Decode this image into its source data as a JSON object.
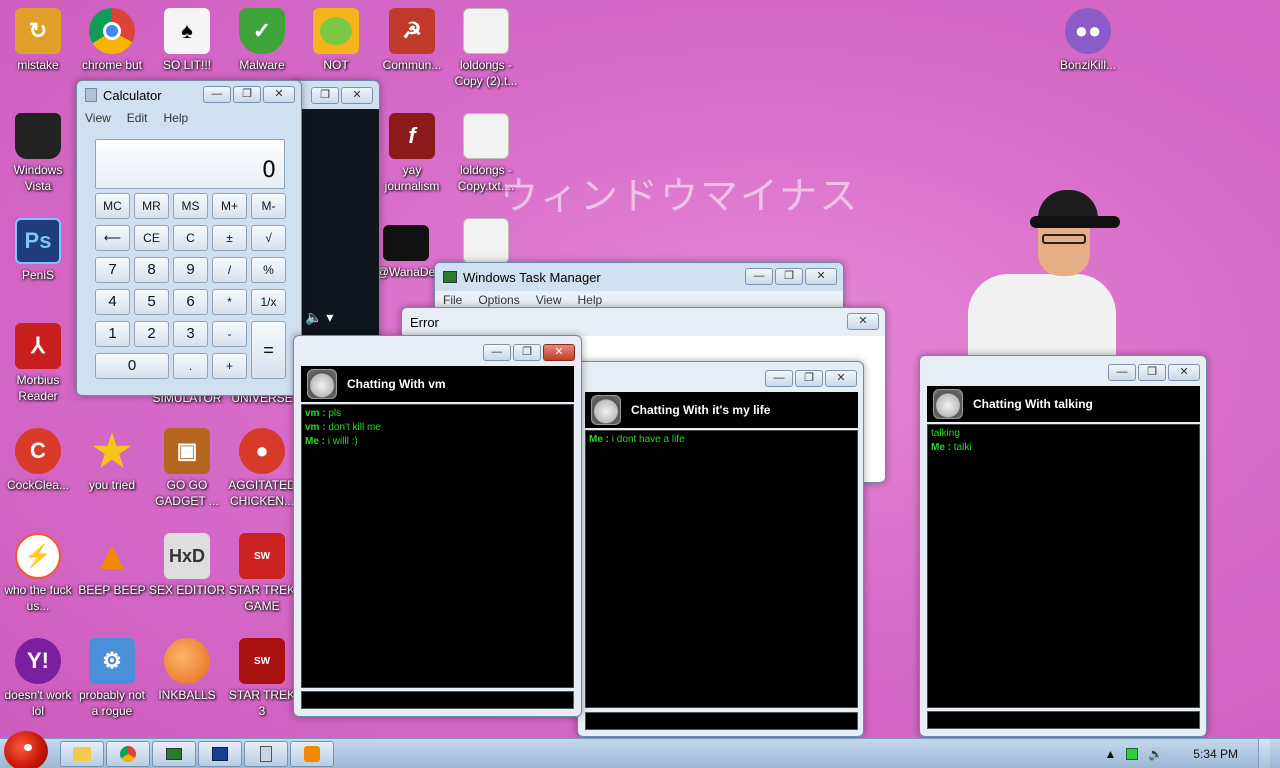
{
  "desktop_icons": [
    {
      "label": "mistake",
      "icon": "folder-arrow-icon",
      "color": "#e0a02a"
    },
    {
      "label": "chrome but",
      "icon": "chrome-icon",
      "color": "#3a7be8"
    },
    {
      "label": "SO LIT!!!",
      "icon": "cards-icon",
      "color": "#f5f5f5"
    },
    {
      "label": "Malware",
      "icon": "shield-check-icon",
      "color": "#3ea43a"
    },
    {
      "label": "NOT",
      "icon": "angry-pig-icon",
      "color": "#7ac943"
    },
    {
      "label": "Commun...",
      "icon": "communism-icon",
      "color": "#c0392b"
    },
    {
      "label": "loldongs - Copy (2).t...",
      "icon": "text-file-icon",
      "color": "#f2f2f2"
    },
    {
      "label": "BonziKill...",
      "icon": "purple-gorilla-icon",
      "color": "#8b5bc7"
    },
    {
      "label": "Windows Vista",
      "icon": "trash-can-icon",
      "color": "#222222"
    },
    {
      "label": "yay journalism",
      "icon": "flash-icon",
      "color": "#8b1a1a"
    },
    {
      "label": "loldongs - Copy.txt....",
      "icon": "text-file-icon",
      "color": "#f2f2f2"
    },
    {
      "label": "PeniS",
      "icon": "photoshop-icon",
      "color": "#1f3d7a"
    },
    {
      "label": "@WanaDe",
      "icon": "black-file-icon",
      "color": "#111111"
    },
    {
      "label": "Morbius Reader",
      "icon": "pdf-icon",
      "color": "#c81e1e"
    },
    {
      "label": "SIMULATOR",
      "icon": "",
      "color": ""
    },
    {
      "label": "UNIVERSE",
      "icon": "",
      "color": ""
    },
    {
      "label": "CockClea...",
      "icon": "ccleaner-icon",
      "color": "#d93a2a"
    },
    {
      "label": "you tried",
      "icon": "star-icon",
      "color": "#f5c518"
    },
    {
      "label": "GO GO GADGET ...",
      "icon": "briefcase-icon",
      "color": "#b5651d"
    },
    {
      "label": "AGGITATED CHICKEN...",
      "icon": "angry-bird-icon",
      "color": "#d63a2a"
    },
    {
      "label": "who the fuck us...",
      "icon": "lightning-icon",
      "color": "#f05a28"
    },
    {
      "label": "BEEP BEEP",
      "icon": "vlc-cone-icon",
      "color": "#f08a00"
    },
    {
      "label": "SEX EDITIOR",
      "icon": "hxd-icon",
      "color": "#dddddd"
    },
    {
      "label": "STAR TREK GAME",
      "icon": "star-wars-icon",
      "color": "#cc2222"
    },
    {
      "label": "doesn't work lol",
      "icon": "yahoo-messenger-icon",
      "color": "#7b1fa2"
    },
    {
      "label": "probably not a rogue",
      "icon": "gear-monitor-icon",
      "color": "#4a8fd8"
    },
    {
      "label": "INKBALLS",
      "icon": "inkball-icon",
      "color": "#e06a1a"
    },
    {
      "label": "STAR TREK 3",
      "icon": "star-wars-icon",
      "color": "#aa1111"
    }
  ],
  "watermark": "ウィンドウマイナス",
  "calculator": {
    "title": "Calculator",
    "menu": [
      "View",
      "Edit",
      "Help"
    ],
    "display": "0",
    "keys": [
      "MC",
      "MR",
      "MS",
      "M+",
      "M-",
      "⟵",
      "CE",
      "C",
      "±",
      "√",
      "7",
      "8",
      "9",
      "/",
      "%",
      "4",
      "5",
      "6",
      "*",
      "1/x",
      "1",
      "2",
      "3",
      "-",
      "=",
      "0",
      ".",
      "+"
    ]
  },
  "task_manager": {
    "title": "Windows Task Manager",
    "menu": [
      "File",
      "Options",
      "View",
      "Help"
    ]
  },
  "error_window": {
    "title": "Error"
  },
  "chats": [
    {
      "title": "Chatting With vm",
      "messages": [
        {
          "who": "vm",
          "text": "pls"
        },
        {
          "who": "vm",
          "text": "don't kill me"
        },
        {
          "who": "Me",
          "text": "i willl :)"
        }
      ]
    },
    {
      "title": "Chatting With it's my life",
      "messages": [
        {
          "who": "Me",
          "text": "i dont have a life"
        }
      ]
    },
    {
      "title": "Chatting With talking",
      "messages": [
        {
          "who": "",
          "text": "talking"
        },
        {
          "who": "Me",
          "text": "talki"
        }
      ]
    }
  ],
  "taskbar": {
    "buttons": [
      "explorer-icon",
      "chrome-icon",
      "task-manager-icon",
      "media-icon",
      "calculator-icon",
      "player-icon"
    ],
    "clock": "5:34 PM"
  },
  "colors": {
    "desktop": "#d86cc9",
    "chat_text": "#22dd22",
    "taskbar": "#b3cce6"
  }
}
